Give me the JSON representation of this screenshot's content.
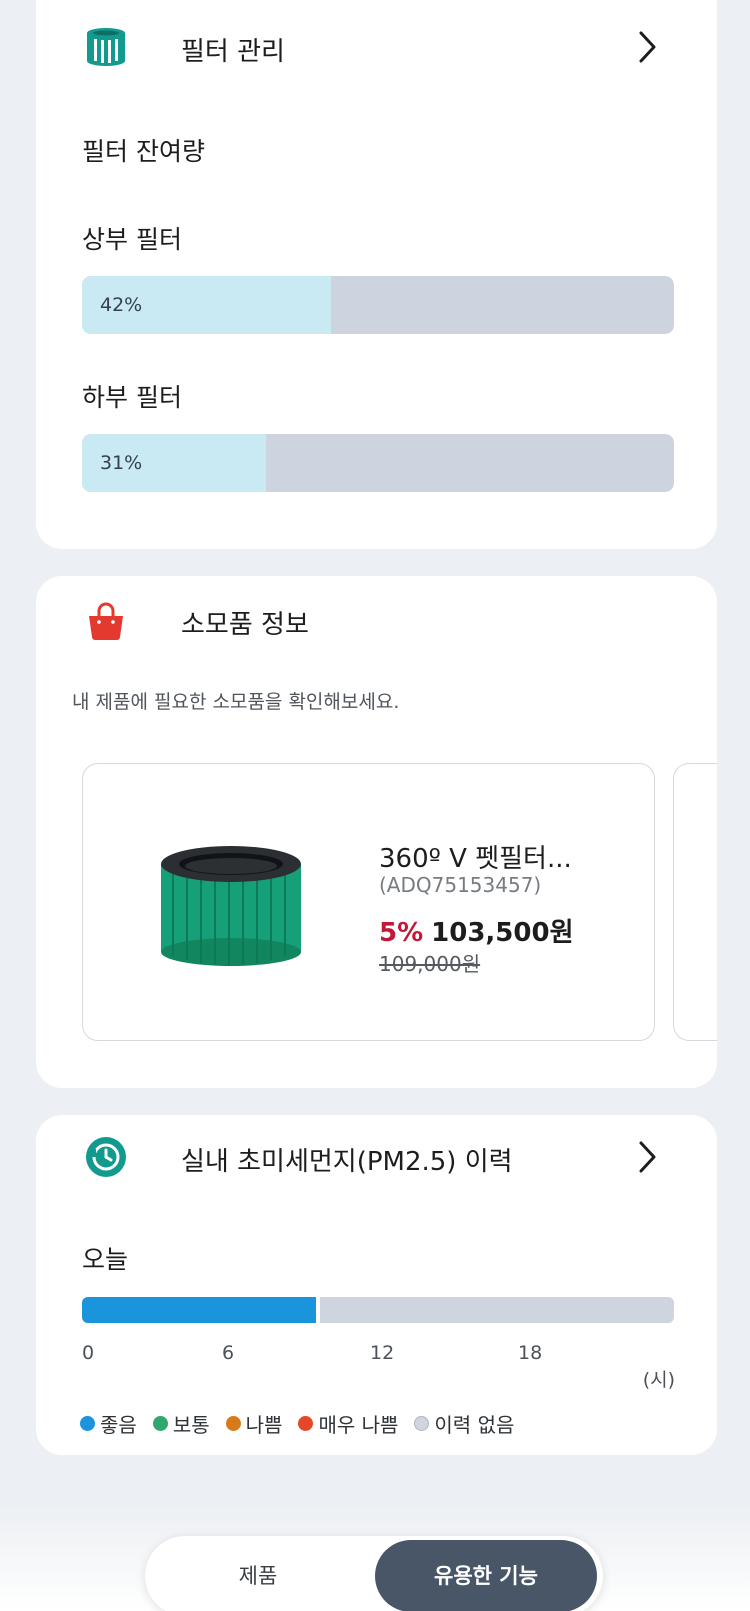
{
  "filter": {
    "title": "필터 관리",
    "remaining_label": "필터 잔여량",
    "upper": {
      "label": "상부 필터",
      "percent_text": "42%",
      "percent": 42
    },
    "lower": {
      "label": "하부 필터",
      "percent_text": "31%",
      "percent": 31
    }
  },
  "supplies": {
    "title": "소모품 정보",
    "subtitle": "내 제품에 필요한 소모품을 확인해보세요.",
    "product": {
      "name": "360º V 펫필터...",
      "code": "(ADQ75153457)",
      "discount": "5%",
      "price": "103,500원",
      "original_price": "109,000원"
    }
  },
  "pm": {
    "title": "실내 초미세먼지(PM2.5) 이력",
    "today_label": "오늘",
    "recorded_hours_good": 9.5,
    "ticks": [
      "0",
      "6",
      "12",
      "18"
    ],
    "unit": "(시)",
    "legend": [
      {
        "label": "좋음",
        "color": "#1a95dc"
      },
      {
        "label": "보통",
        "color": "#2fa86e"
      },
      {
        "label": "나쁨",
        "color": "#d77b1a"
      },
      {
        "label": "매우 나쁨",
        "color": "#e5472b"
      },
      {
        "label": "이력 없음",
        "color": "#cfd5df"
      }
    ]
  },
  "tabs": {
    "product": "제품",
    "useful": "유용한 기능"
  }
}
